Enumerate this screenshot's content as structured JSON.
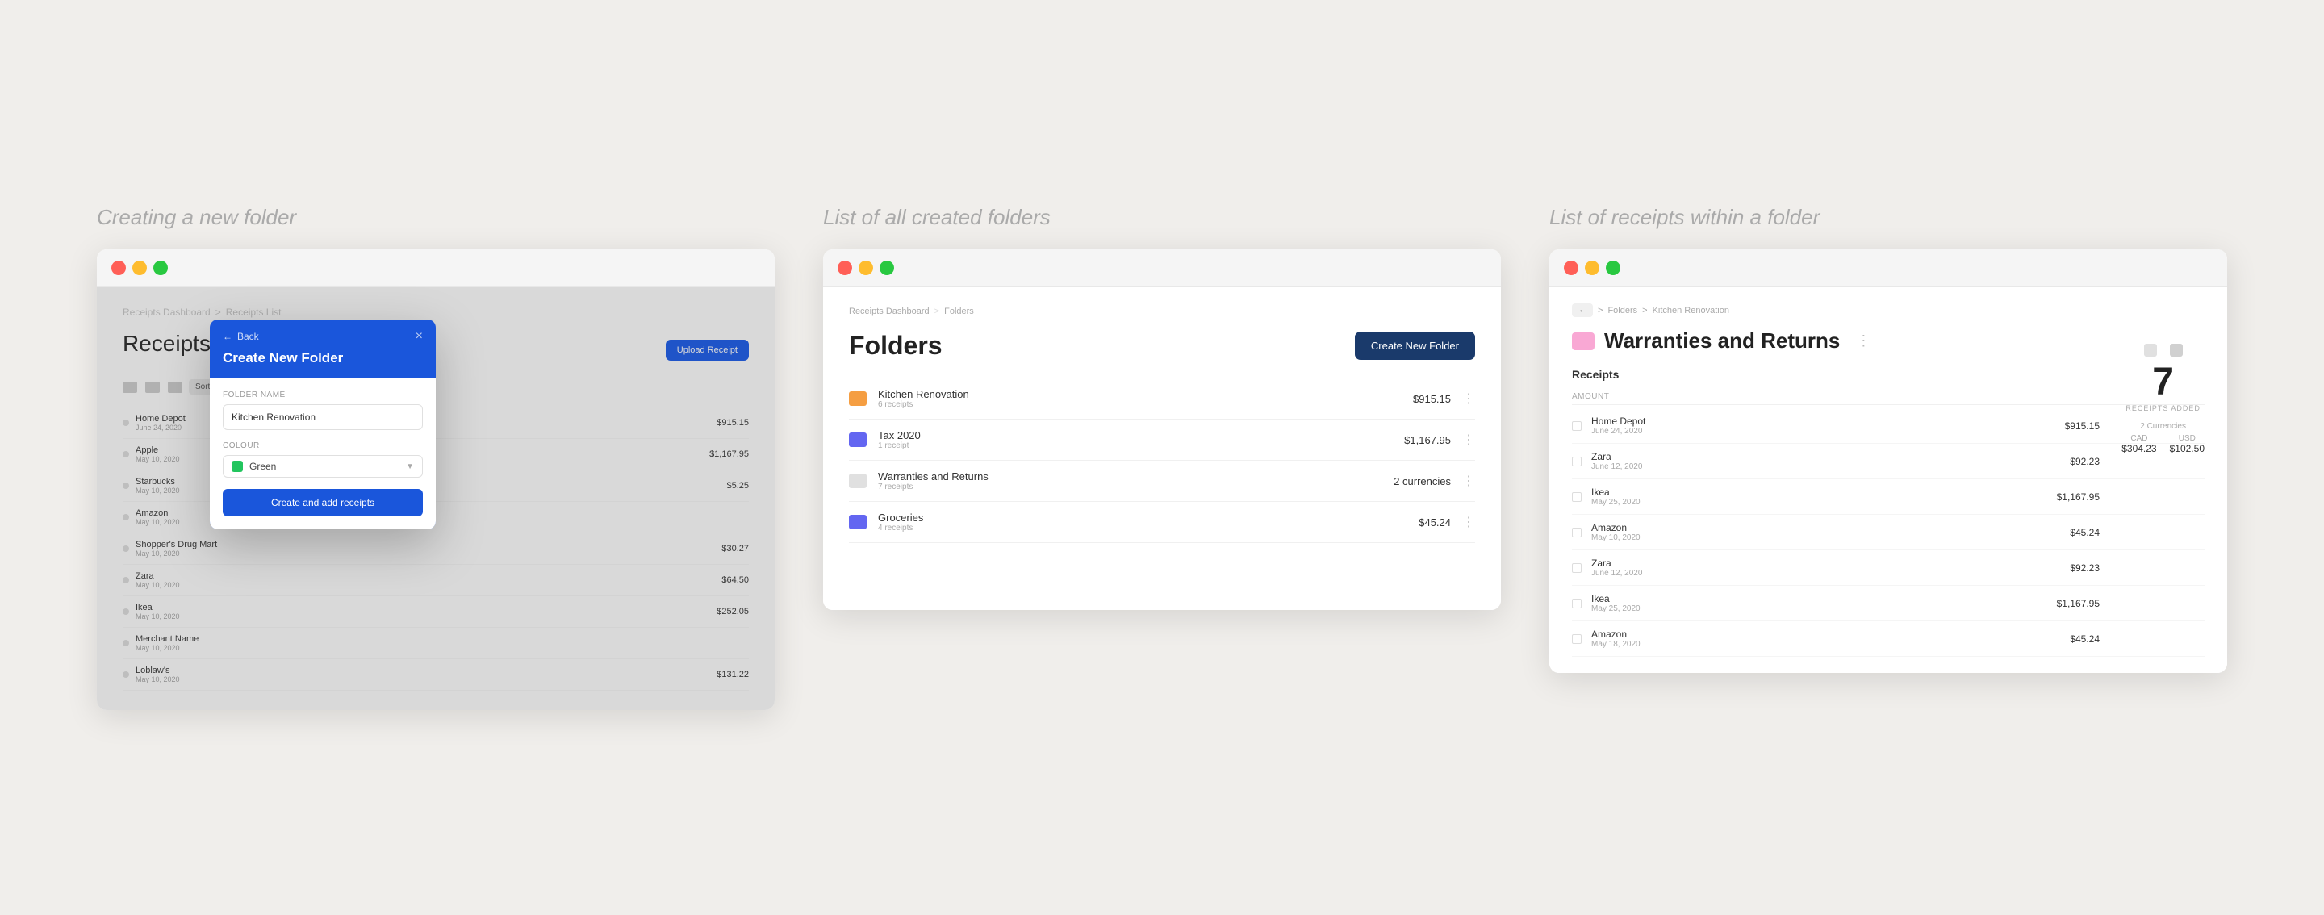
{
  "captions": {
    "panel1": "Creating a new folder",
    "panel2": "List of all created folders",
    "panel3": "List of receipts within a folder"
  },
  "panel1": {
    "nav": [
      "Receipts Dashboard",
      ">",
      "Receipts List"
    ],
    "title": "Receipts List",
    "upload_btn": "Upload Receipt",
    "modal": {
      "back": "Back",
      "close": "×",
      "title": "Create New Folder",
      "folder_name_label": "Folder Name",
      "folder_name_value": "Kitchen Renovation",
      "color_label": "Colour",
      "color_name": "Green",
      "submit_btn": "Create and add receipts"
    },
    "receipts": [
      {
        "name": "Home Depot",
        "date": "June 24, 2020",
        "amount": "$915.15"
      },
      {
        "name": "Apple",
        "date": "May 10, 2020",
        "amount": "$1,167.95"
      },
      {
        "name": "Starbucks",
        "date": "May 10, 2020",
        "amount": "$5.25"
      },
      {
        "name": "Amazon",
        "date": "May 10, 2020",
        "amount": ""
      },
      {
        "name": "Shopper's Drug Mart",
        "date": "May 10, 2020",
        "amount": "$30.27"
      },
      {
        "name": "Zara",
        "date": "May 10, 2020",
        "amount": "$64.50"
      },
      {
        "name": "Ikea",
        "date": "May 10, 2020",
        "amount": "$252.05"
      },
      {
        "name": "Merchant Name",
        "date": "May 10, 2020",
        "amount": ""
      },
      {
        "name": "Loblaw's",
        "date": "May 10, 2020",
        "amount": "$131.22"
      }
    ]
  },
  "panel2": {
    "nav": [
      "Receipts Dashboard",
      ">",
      "Folders"
    ],
    "title": "Folders",
    "create_btn": "Create New Folder",
    "folders": [
      {
        "name": "Kitchen Renovation",
        "sub": "6 receipts",
        "amount": "$915.15",
        "color": "#f59e42"
      },
      {
        "name": "Tax 2020",
        "sub": "1 receipt",
        "amount": "$1,167.95",
        "color": "#6366f1"
      },
      {
        "name": "Warranties and Returns",
        "sub": "7 receipts",
        "amount": "2 currencies",
        "color": "#e0e0e0"
      },
      {
        "name": "Groceries",
        "sub": "4 receipts",
        "amount": "$45.24",
        "color": "#6366f1"
      }
    ]
  },
  "panel3": {
    "nav_home": "←",
    "breadcrumb": [
      "Folders",
      ">",
      "Kitchen Renovation"
    ],
    "folder_color": "#f9a8d4",
    "title": "Warranties and Returns",
    "section_title": "Receipts",
    "stats_num": "7",
    "stats_label": "RECEIPTS ADDED",
    "currencies_label": "2 Currencies",
    "currencies": [
      {
        "code": "CAD",
        "value": "$304.23"
      },
      {
        "code": "USD",
        "value": "$102.50"
      }
    ],
    "receipts": [
      {
        "name": "Home Depot",
        "date": "June 24, 2020",
        "amount": "$915.15"
      },
      {
        "name": "Zara",
        "date": "June 12, 2020",
        "amount": "$92.23"
      },
      {
        "name": "Ikea",
        "date": "May 25, 2020",
        "amount": "$1,167.95"
      },
      {
        "name": "Amazon",
        "date": "May 10, 2020",
        "amount": "$45.24"
      },
      {
        "name": "Zara",
        "date": "June 12, 2020",
        "amount": "$92.23"
      },
      {
        "name": "Ikea",
        "date": "May 25, 2020",
        "amount": "$1,167.95"
      },
      {
        "name": "Amazon",
        "date": "May 18, 2020",
        "amount": "$45.24"
      }
    ]
  },
  "colors": {
    "red": "#ff5f57",
    "yellow": "#febc2e",
    "green": "#28c840",
    "blue": "#1a56db",
    "dark_blue": "#1a3a6b"
  }
}
